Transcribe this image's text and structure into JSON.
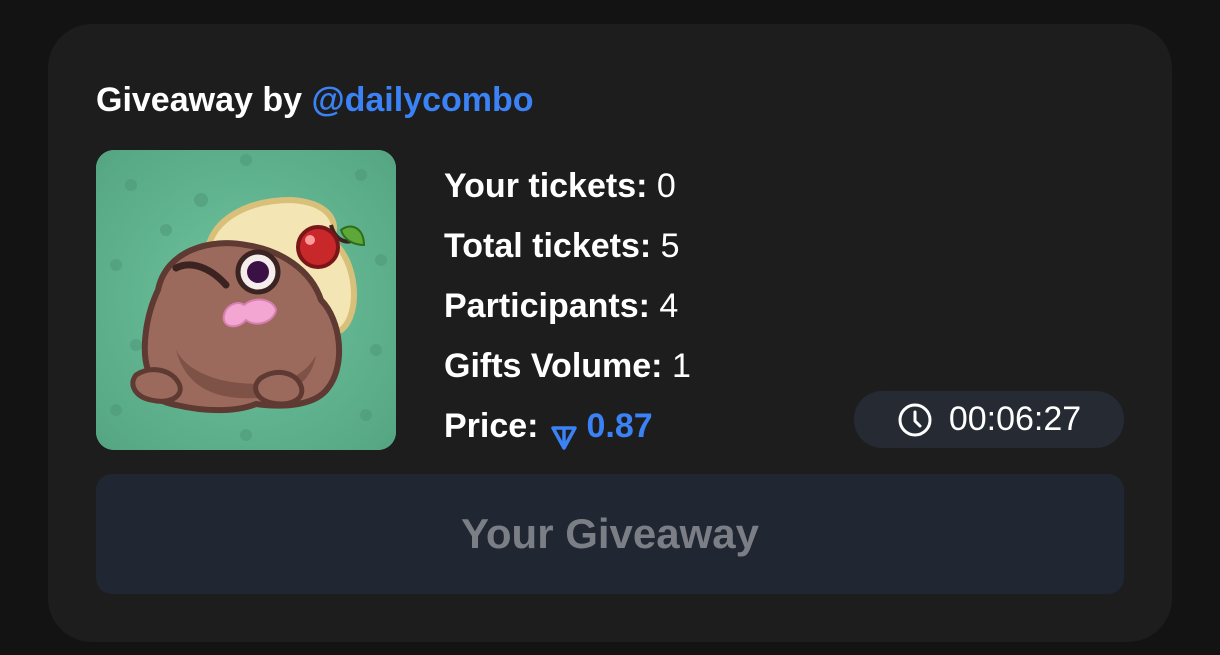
{
  "header": {
    "prefix": "Giveaway by",
    "handle": "@dailycombo"
  },
  "gift": {
    "image_icon": "frog-gift-icon"
  },
  "stats": [
    {
      "label": "Your tickets:",
      "value": "0"
    },
    {
      "label": "Total tickets:",
      "value": "5"
    },
    {
      "label": "Participants:",
      "value": "4"
    },
    {
      "label": "Gifts Volume:",
      "value": "1"
    }
  ],
  "price": {
    "label": "Price:",
    "currency_icon": "ton-icon",
    "value": "0.87"
  },
  "timer": {
    "icon": "clock-icon",
    "value": "00:06:27"
  },
  "action": {
    "label": "Your Giveaway"
  },
  "colors": {
    "accent": "#3b82f6",
    "card_bg": "#1d1d1d",
    "page_bg": "#131313",
    "button_bg": "#202632",
    "timer_bg": "#252a33"
  }
}
